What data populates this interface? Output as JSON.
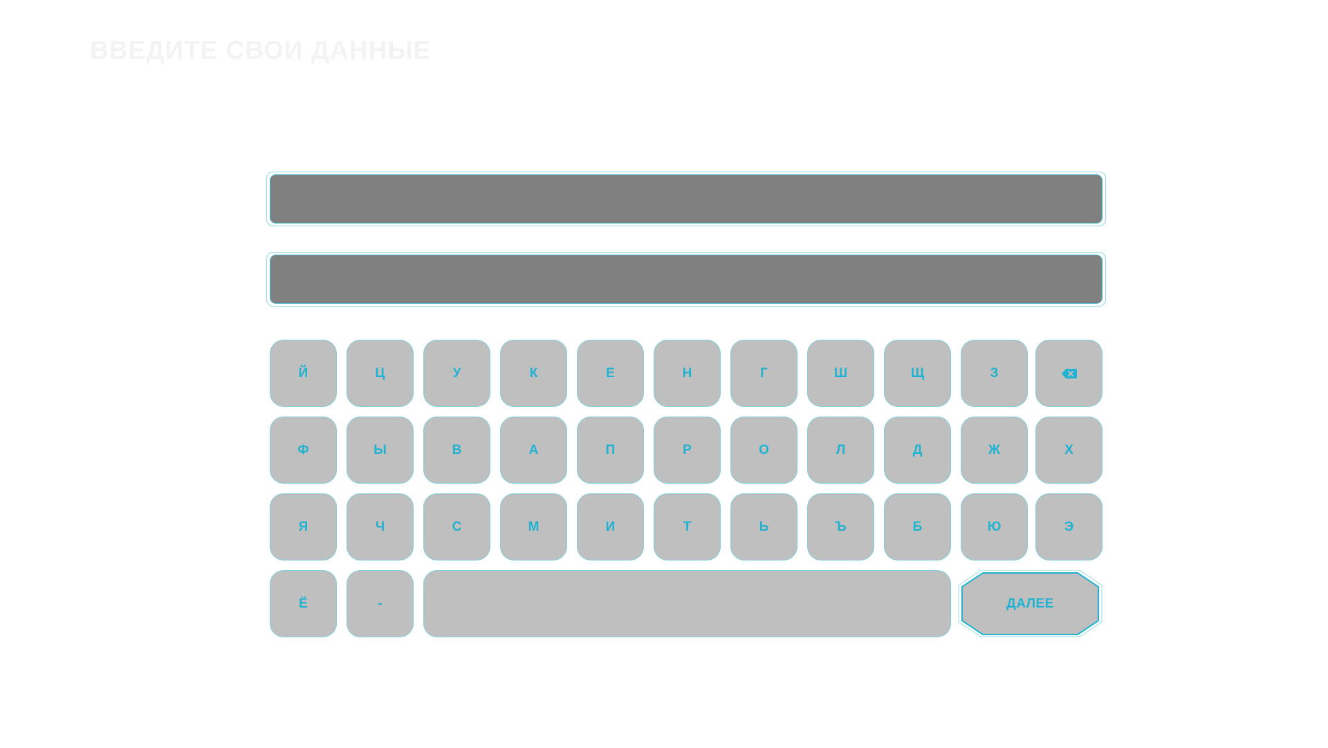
{
  "title": "ВВЕДИТЕ СВОИ ДАННЫЕ",
  "fields": [
    {
      "value": ""
    },
    {
      "value": ""
    }
  ],
  "keyboard": {
    "rows": [
      [
        "Й",
        "Ц",
        "У",
        "К",
        "Е",
        "Н",
        "Г",
        "Ш",
        "Щ",
        "З"
      ],
      [
        "Ф",
        "Ы",
        "В",
        "А",
        "П",
        "Р",
        "О",
        "Л",
        "Д",
        "Ж",
        "Х"
      ],
      [
        "Я",
        "Ч",
        "С",
        "М",
        "И",
        "Т",
        "Ь",
        "Ъ",
        "Б",
        "Ю",
        "Э"
      ],
      [
        "Ё",
        "-"
      ]
    ],
    "backspace_icon": "backspace-icon",
    "space_label": "",
    "next_label": "ДАЛЕЕ"
  },
  "colors": {
    "accent": "#1fb3d1",
    "key_fill": "#bfbfbf",
    "field_fill": "#808080",
    "border": "#7fcfdc"
  }
}
